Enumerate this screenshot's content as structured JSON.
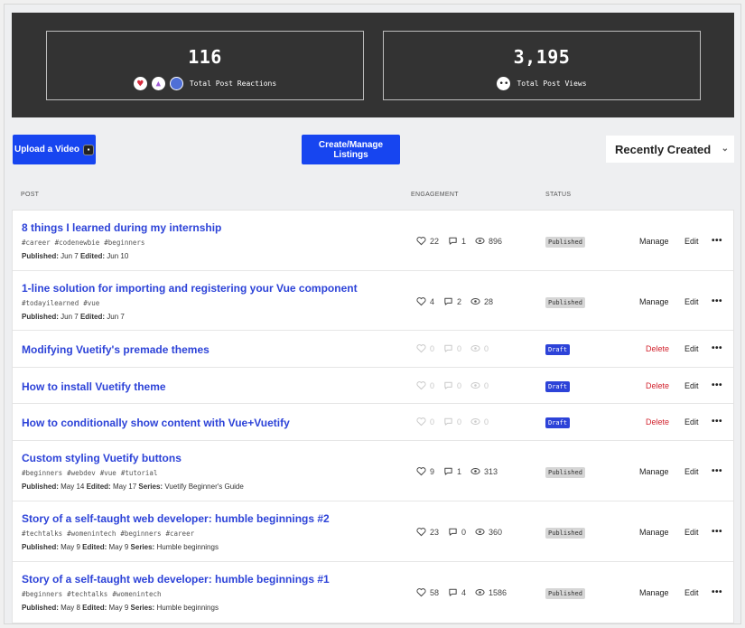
{
  "stats": {
    "reactions": {
      "value": "116",
      "label": "Total Post Reactions"
    },
    "views": {
      "value": "3,195",
      "label": "Total Post Views"
    }
  },
  "toolbar": {
    "upload_label": "Upload a Video",
    "listings_label": "Create/Manage Listings",
    "sort_value": "Recently Created"
  },
  "columns": {
    "post": "POST",
    "engagement": "ENGAGEMENT",
    "status": "STATUS"
  },
  "actions": {
    "manage": "Manage",
    "delete": "Delete",
    "edit": "Edit",
    "more": "•••"
  },
  "posts": [
    {
      "title": "8 things I learned during my internship",
      "tags": [
        "#career",
        "#codenewbie",
        "#beginners"
      ],
      "published": "Jun 7",
      "edited": "Jun 10",
      "series": "",
      "likes": "22",
      "comments": "1",
      "views": "896",
      "status": "Published",
      "primary_action": "Manage"
    },
    {
      "title": "1-line solution for importing and registering your Vue component",
      "tags": [
        "#todayilearned",
        "#vue"
      ],
      "published": "Jun 7",
      "edited": "Jun 7",
      "series": "",
      "likes": "4",
      "comments": "2",
      "views": "28",
      "status": "Published",
      "primary_action": "Manage"
    },
    {
      "title": "Modifying Vuetify's premade themes",
      "tags": [],
      "published": "",
      "edited": "",
      "series": "",
      "likes": "0",
      "comments": "0",
      "views": "0",
      "status": "Draft",
      "primary_action": "Delete"
    },
    {
      "title": "How to install Vuetify theme",
      "tags": [],
      "published": "",
      "edited": "",
      "series": "",
      "likes": "0",
      "comments": "0",
      "views": "0",
      "status": "Draft",
      "primary_action": "Delete"
    },
    {
      "title": "How to conditionally show content with Vue+Vuetify",
      "tags": [],
      "published": "",
      "edited": "",
      "series": "",
      "likes": "0",
      "comments": "0",
      "views": "0",
      "status": "Draft",
      "primary_action": "Delete"
    },
    {
      "title": "Custom styling Vuetify buttons",
      "tags": [
        "#beginners",
        "#webdev",
        "#vue",
        "#tutorial"
      ],
      "published": "May 14",
      "edited": "May 17",
      "series": "Vuetify Beginner's Guide",
      "likes": "9",
      "comments": "1",
      "views": "313",
      "status": "Published",
      "primary_action": "Manage"
    },
    {
      "title": "Story of a self-taught web developer: humble beginnings #2",
      "tags": [
        "#techtalks",
        "#womenintech",
        "#beginners",
        "#career"
      ],
      "published": "May 9",
      "edited": "May 9",
      "series": "Humble beginnings",
      "likes": "23",
      "comments": "0",
      "views": "360",
      "status": "Published",
      "primary_action": "Manage"
    },
    {
      "title": "Story of a self-taught web developer: humble beginnings #1",
      "tags": [
        "#beginners",
        "#techtalks",
        "#womenintech"
      ],
      "published": "May 8",
      "edited": "May 9",
      "series": "Humble beginnings",
      "likes": "58",
      "comments": "4",
      "views": "1586",
      "status": "Published",
      "primary_action": "Manage"
    }
  ],
  "labels": {
    "published": "Published:",
    "edited": "Edited:",
    "series": "Series:"
  },
  "colors": {
    "accent": "#1745f0",
    "link": "#2d43d8",
    "delete": "#d2222d",
    "stats_bg": "#333333"
  }
}
